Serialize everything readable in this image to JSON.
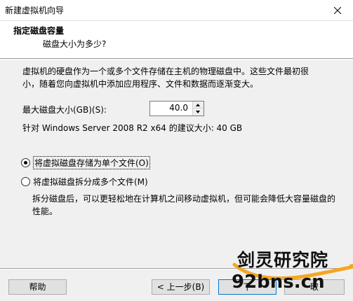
{
  "window": {
    "title": "新建虚拟机向导"
  },
  "header": {
    "title": "指定磁盘容量",
    "subtitle": "磁盘大小为多少?"
  },
  "description": {
    "line1": "虚拟机的硬盘作为一个或多个文件存储在主机的物理磁盘中。这些文件最初很",
    "line2": "小，随着您向虚拟机中添加应用程序、文件和数据而逐渐变大。"
  },
  "disk_size": {
    "label": "最大磁盘大小(GB)(S):",
    "value": "40.0"
  },
  "recommendation": "针对 Windows Server 2008 R2 x64 的建议大小: 40 GB",
  "storage_options": [
    {
      "label": "将虚拟磁盘存储为单个文件(O)",
      "selected": true
    },
    {
      "label": "将虚拟磁盘拆分成多个文件(M)",
      "selected": false
    }
  ],
  "split_description": {
    "line1": "拆分磁盘后，可以更轻松地在计算机之间移动虚拟机，但可能会降低大容量磁盘的",
    "line2": "性能。"
  },
  "buttons": {
    "help": "帮助",
    "back": "< 上一步(B)",
    "next": "下",
    "finish": "取"
  },
  "watermark": {
    "line1": "剑灵研究院",
    "line2": "92bns.cn"
  },
  "colors": {
    "accent_orange": "#f5a623",
    "focus_blue": "#0078d7"
  }
}
